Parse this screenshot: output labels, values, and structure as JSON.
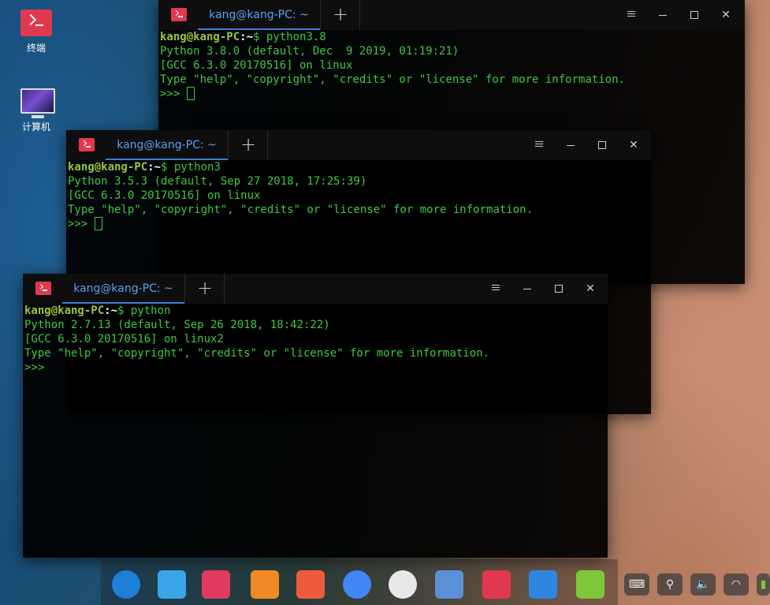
{
  "desktop": {
    "icons": [
      {
        "label": "终端",
        "icon": "terminal-icon"
      },
      {
        "label": "计算机",
        "icon": "computer-icon"
      }
    ]
  },
  "windows": [
    {
      "tab_label": "kang@kang-PC: ~",
      "prompt_user": "kang@kang-PC",
      "prompt_sep": ":",
      "prompt_path": "~",
      "command": "$ python3.8",
      "output": [
        "Python 3.8.0 (default, Dec  9 2019, 01:19:21)",
        "[GCC 6.3.0 20170516] on linux",
        "Type \"help\", \"copyright\", \"credits\" or \"license\" for more information."
      ],
      "repl_prompt": ">>> "
    },
    {
      "tab_label": "kang@kang-PC: ~",
      "prompt_user": "kang@kang-PC",
      "prompt_sep": ":",
      "prompt_path": "~",
      "command": "$ python3",
      "output": [
        "Python 3.5.3 (default, Sep 27 2018, 17:25:39)",
        "[GCC 6.3.0 20170516] on linux",
        "Type \"help\", \"copyright\", \"credits\" or \"license\" for more information."
      ],
      "repl_prompt": ">>> "
    },
    {
      "tab_label": "kang@kang-PC: ~",
      "prompt_user": "kang@kang-PC",
      "prompt_sep": ":",
      "prompt_path": "~",
      "command": "$ python",
      "output": [
        "Python 2.7.13 (default, Sep 26 2018, 18:42:22)",
        "[GCC 6.3.0 20170516] on linux2",
        "Type \"help\", \"copyright\", \"credits\" or \"license\" for more information."
      ],
      "repl_prompt": ">>>"
    }
  ],
  "dock": {
    "items": [
      {
        "name": "launcher-icon",
        "color": "#1e7fd6"
      },
      {
        "name": "file-manager-icon",
        "color": "#3aa6e8"
      },
      {
        "name": "screenshot-icon",
        "color": "#e03a5e"
      },
      {
        "name": "app-store-icon",
        "color": "#f08a24"
      },
      {
        "name": "screen-recorder-icon",
        "color": "#f05a3c"
      },
      {
        "name": "chrome-icon",
        "color": "#4285f4"
      },
      {
        "name": "settings-icon",
        "color": "#e8e8e8"
      },
      {
        "name": "notes-icon",
        "color": "#5b8fd6"
      },
      {
        "name": "terminal-icon",
        "color": "#e0394f"
      },
      {
        "name": "video-player-icon",
        "color": "#2f86e0"
      },
      {
        "name": "music-icon",
        "color": "#7dc73b"
      }
    ]
  },
  "tray": {
    "items": [
      {
        "name": "keyboard-icon",
        "glyph": "⌨"
      },
      {
        "name": "usb-icon",
        "glyph": "⚲"
      },
      {
        "name": "volume-icon",
        "glyph": "🔈"
      },
      {
        "name": "wifi-icon",
        "glyph": "◠"
      },
      {
        "name": "battery-icon",
        "glyph": "▮"
      }
    ]
  }
}
